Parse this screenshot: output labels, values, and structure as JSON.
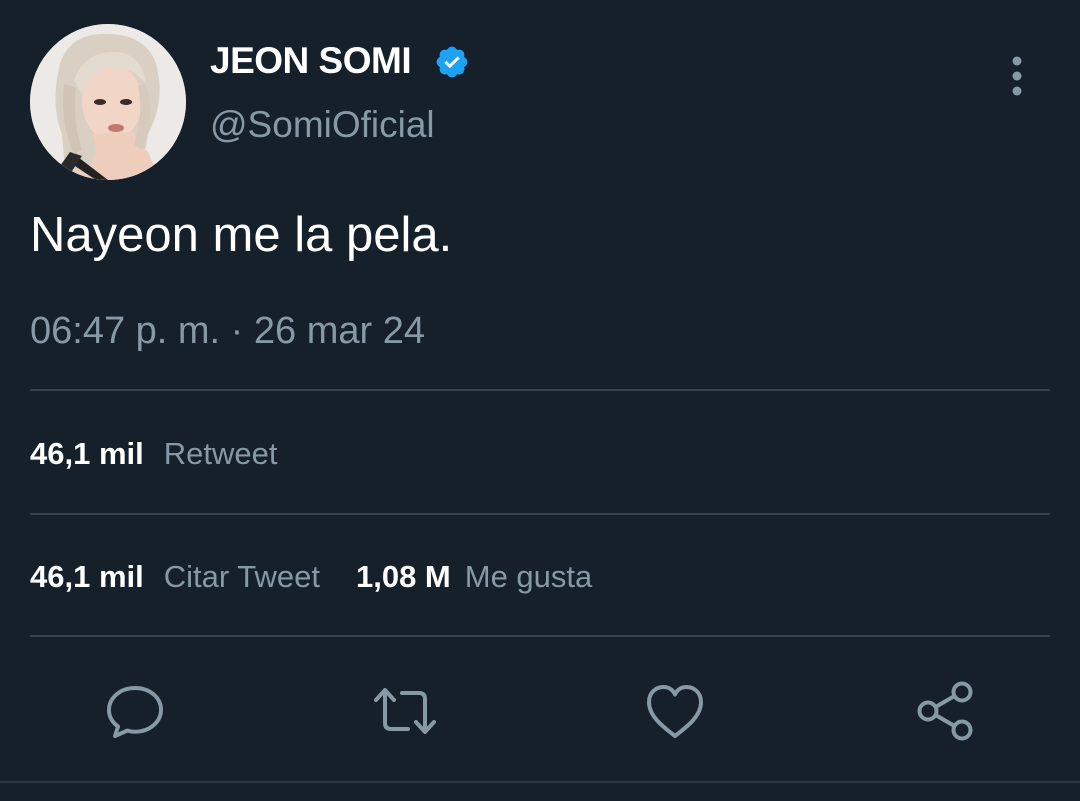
{
  "tweet": {
    "author": {
      "display_name": "JEON SOMI",
      "handle": "@SomiOficial",
      "verified": true
    },
    "text": "Nayeon me la pela.",
    "timestamp": "06:47 p. m. · 26 mar 24",
    "stats": {
      "retweets": {
        "value": "46,1 mil",
        "label": "Retweet"
      },
      "quotes": {
        "value": "46,1 mil",
        "label": "Citar Tweet"
      },
      "likes": {
        "value": "1,08 M",
        "label": "Me gusta"
      }
    },
    "actions": [
      "reply-icon",
      "retweet-icon",
      "like-icon",
      "share-icon"
    ]
  },
  "colors": {
    "background": "#15202b",
    "primary_text": "#ffffff",
    "secondary_text": "#8899a6",
    "divider": "#38444d",
    "verified_blue": "#1da1f2"
  }
}
